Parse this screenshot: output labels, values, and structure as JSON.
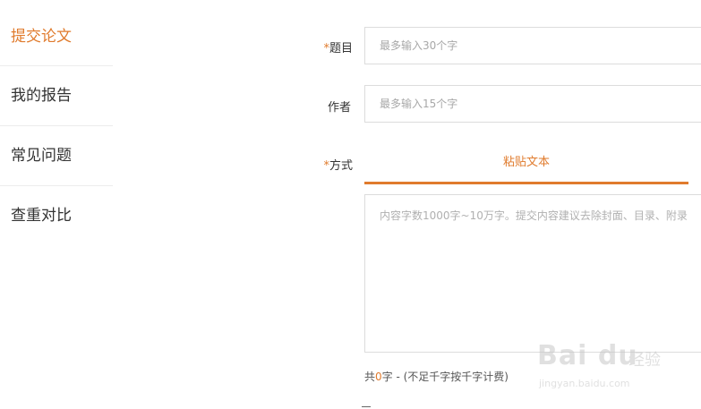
{
  "sidebar": {
    "items": [
      {
        "label": "提交论文",
        "active": true
      },
      {
        "label": "我的报告",
        "active": false
      },
      {
        "label": "常见问题",
        "active": false
      },
      {
        "label": "查重对比",
        "active": false
      }
    ]
  },
  "form": {
    "title": {
      "required_mark": "*",
      "label": "题目",
      "placeholder": "最多输入30个字"
    },
    "author": {
      "label": "作者",
      "placeholder": "最多输入15个字"
    },
    "method": {
      "required_mark": "*",
      "label": "方式",
      "tab_label": "粘贴文本"
    },
    "content": {
      "placeholder": "内容字数1000字~10万字。提交内容建议去除封面、目录、附录"
    },
    "count": {
      "prefix": "共",
      "value": "0",
      "suffix": "字 - (不足千字按千字计费)"
    }
  },
  "watermark": {
    "logo": "Bai du",
    "brand": "经验",
    "url": "jingyan.baidu.com"
  },
  "colors": {
    "accent": "#e07b2d",
    "border": "#dcdcdc",
    "divider": "#ececec"
  }
}
